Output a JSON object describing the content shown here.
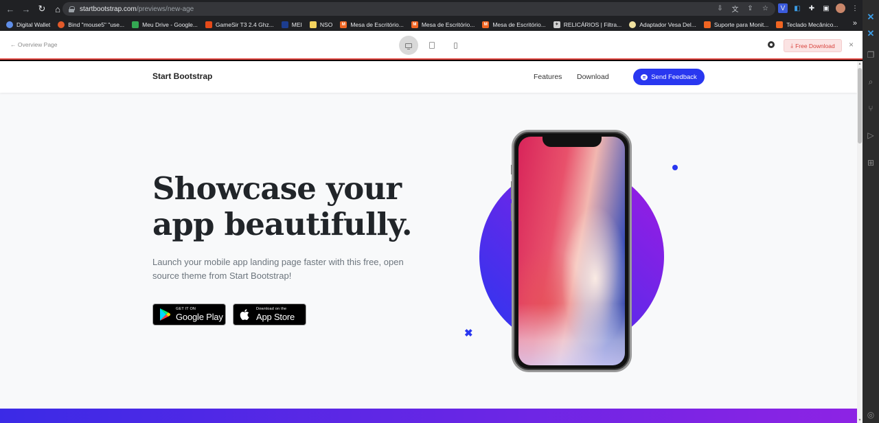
{
  "browser": {
    "url_host": "startbootstrap.com",
    "url_path": "/previews/new-age",
    "bookmarks": [
      {
        "label": "Digital Wallet",
        "color": "#5f8ee8"
      },
      {
        "label": "Bind \"mouse5\" \"use...",
        "color": "#e25a2a"
      },
      {
        "label": "Meu Drive - Google...",
        "color": "#34a853"
      },
      {
        "label": "GameSir T3 2.4 Ghz...",
        "color": "#e64a19"
      },
      {
        "label": "MEI",
        "color": "#1c3d8f"
      },
      {
        "label": "NSO",
        "color": "#f4d35e"
      },
      {
        "label": "Mesa de Escritório...",
        "color": "#f06522"
      },
      {
        "label": "Mesa de Escritório...",
        "color": "#f06522"
      },
      {
        "label": "Mesa de Escritório...",
        "color": "#f06522"
      },
      {
        "label": "RELICÁRIOS | Filtra...",
        "color": "#cfcfcf"
      },
      {
        "label": "Adaptador Vesa Del...",
        "color": "#f1e2a0"
      },
      {
        "label": "Suporte para Monit...",
        "color": "#f06522"
      },
      {
        "label": "Teclado Mecânico...",
        "color": "#f06522"
      }
    ]
  },
  "preview_bar": {
    "back_label": "Overview Page",
    "free_download_label": "Free Download"
  },
  "site": {
    "brand": "Start Bootstrap",
    "nav_features": "Features",
    "nav_download": "Download",
    "feedback_label": "Send Feedback",
    "hero_title_line1": "Showcase your",
    "hero_title_line2": "app beautifully.",
    "hero_lead": "Launch your mobile app landing page faster with this free, open source theme from Start Bootstrap!",
    "google_small": "GET IT ON",
    "google_big": "Google Play",
    "apple_small": "Download on the",
    "apple_big": "App Store"
  },
  "colors": {
    "primary": "#2937f0",
    "secondary": "#9f1ae2",
    "free_download": "#d8433d"
  }
}
